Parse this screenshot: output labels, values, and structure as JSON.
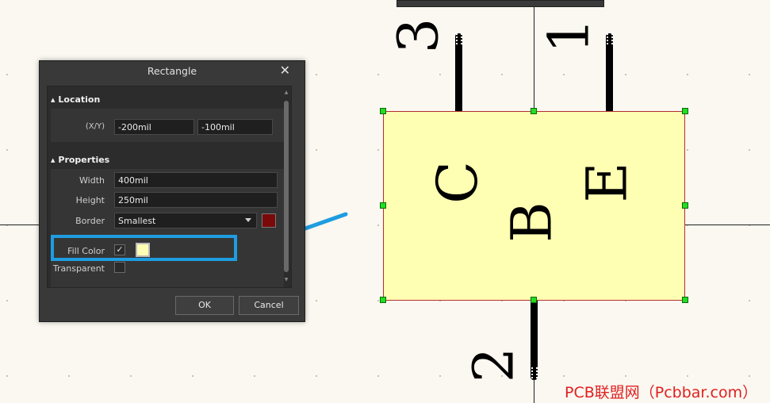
{
  "dialog": {
    "title": "Rectangle",
    "close_glyph": "✕",
    "sections": {
      "location": {
        "header": "Location",
        "xy_label": "(X/Y)",
        "x_value": "-200mil",
        "y_value": "-100mil"
      },
      "properties": {
        "header": "Properties",
        "width_label": "Width",
        "width_value": "400mil",
        "height_label": "Height",
        "height_value": "250mil",
        "border_label": "Border",
        "border_value": "Smallest",
        "border_color": "#7a0a0a",
        "fill_color_label": "Fill Color",
        "fill_color_checked": "✓",
        "fill_color": "#ffffb3",
        "transparent_label": "Transparent"
      }
    },
    "buttons": {
      "ok": "OK",
      "cancel": "Cancel"
    }
  },
  "schematic": {
    "body_color": "#ffffb3",
    "border_color": "#b03030",
    "handle_color": "#22dd22",
    "pin_labels": [
      "3",
      "1",
      "2"
    ],
    "body_letters": [
      "C",
      "B",
      "E"
    ]
  },
  "annotation": {
    "highlight_color": "#1e9de0"
  },
  "watermark": "PCB联盟网（Pcbbar.com）"
}
